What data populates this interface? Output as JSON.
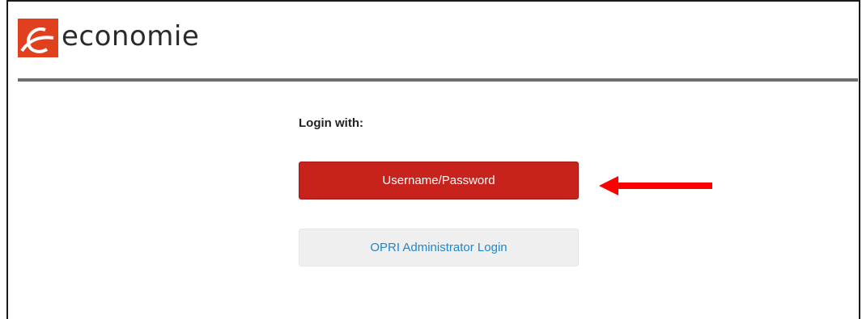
{
  "brand": {
    "name": "economie",
    "logo_icon": "economie-e-logo-icon",
    "logo_color": "#e0401e"
  },
  "login": {
    "label": "Login with:",
    "primary_button_label": "Username/Password",
    "secondary_button_label": "OPRI Administrator Login"
  },
  "annotation": {
    "arrow_icon": "arrow-left-icon",
    "arrow_color": "#ff0000"
  },
  "colors": {
    "primary_button": "#c7221c",
    "secondary_button_bg": "#efefef",
    "secondary_button_text": "#1f86c7",
    "header_rule": "#6e6e6e"
  }
}
